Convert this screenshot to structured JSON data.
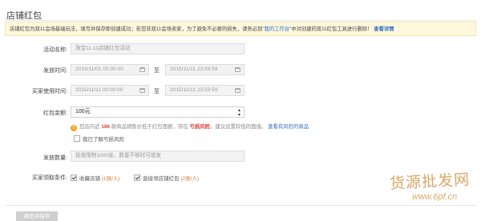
{
  "page": {
    "title": "店铺红包"
  },
  "notice": {
    "text_before": "店铺红包为双11会场基础玩法，填写并保存即创建成功；若您非双11会场卖家，为了避免不必要的损失，请务必到",
    "link_text": "\"我的工作台\"",
    "text_after": "中对创建的双11红包工具进行删除！",
    "detail_link": "查看详情"
  },
  "form": {
    "name": {
      "label": "活动名称:",
      "placeholder": "淘宝11.11店铺红包活动"
    },
    "issue_time": {
      "label": "发放时间:",
      "start": "2015/11/01 00:00:00",
      "separator": "至",
      "end": "2015/11/11 23:59:59"
    },
    "use_time": {
      "label": "买家使用时间:",
      "start": "2015/11/11 00:00:00",
      "separator": "至",
      "end": "2015/11/11 23:59:59"
    },
    "amount": {
      "label": "红包金额:",
      "selected": "100元",
      "warning_before": "您店内近",
      "warning_count": "186",
      "warning_middle": "款商品销售价低于红包面额，存在",
      "warning_risk": "亏损风险",
      "warning_after": "，建议设置较低的面值。",
      "risk_link": "查看有风险的商品",
      "ack_label": "我已了解亏损风险",
      "ack_checked": false
    },
    "quantity": {
      "label": "发放数量:",
      "placeholder": "投放限制1000张，数量不够时可增发"
    },
    "conditions": {
      "label": "买家领取条件:",
      "options": [
        {
          "label": "收藏店铺",
          "detail": "(1张/人)",
          "checked": true
        },
        {
          "label": "直接领店铺红包",
          "detail": "(2张/人)",
          "checked": true
        }
      ]
    }
  },
  "actions": {
    "submit_label": "确定并保存"
  },
  "watermark": {
    "text": "货源批发网",
    "url": "www.6pf.cn"
  }
}
